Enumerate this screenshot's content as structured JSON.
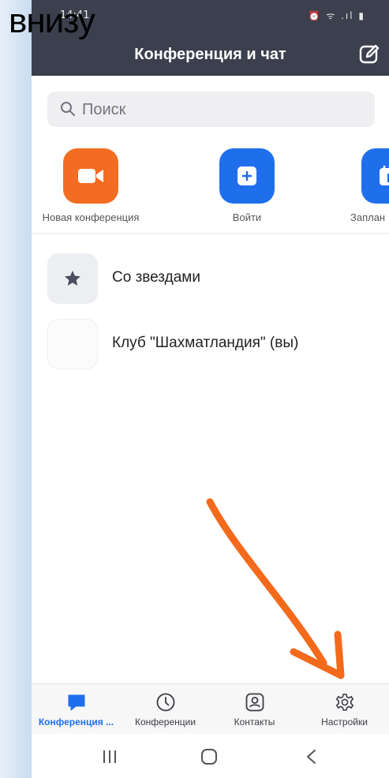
{
  "caption": "внизу",
  "status_bar": {
    "time": "14:41",
    "icons": "⏰ ᯤ .ıl ▮"
  },
  "header": {
    "title": "Конференция и чат"
  },
  "search": {
    "placeholder": "Поиск"
  },
  "actions": [
    {
      "label": "Новая конференция",
      "icon": "video-camera-icon",
      "color": "#f26c21"
    },
    {
      "label": "Войти",
      "icon": "plus-icon",
      "color": "#1f6fed"
    },
    {
      "label": "Заплан",
      "icon": "calendar-icon",
      "color": "#1f6fed"
    }
  ],
  "contacts": [
    {
      "label": "Со звездами",
      "icon": "star-icon"
    },
    {
      "label": "Клуб \"Шахматландия\" (вы)",
      "icon": "blank-avatar"
    }
  ],
  "tabs": [
    {
      "label": "Конференция ...",
      "icon": "chat-bubble-icon",
      "active": true
    },
    {
      "label": "Конференции",
      "icon": "clock-icon",
      "active": false
    },
    {
      "label": "Контакты",
      "icon": "contact-card-icon",
      "active": false
    },
    {
      "label": "Настройки",
      "icon": "gear-icon",
      "active": false
    }
  ],
  "colors": {
    "accent": "#1f6fed",
    "header": "#3c3f4d",
    "arrow": "#f36a1c"
  }
}
